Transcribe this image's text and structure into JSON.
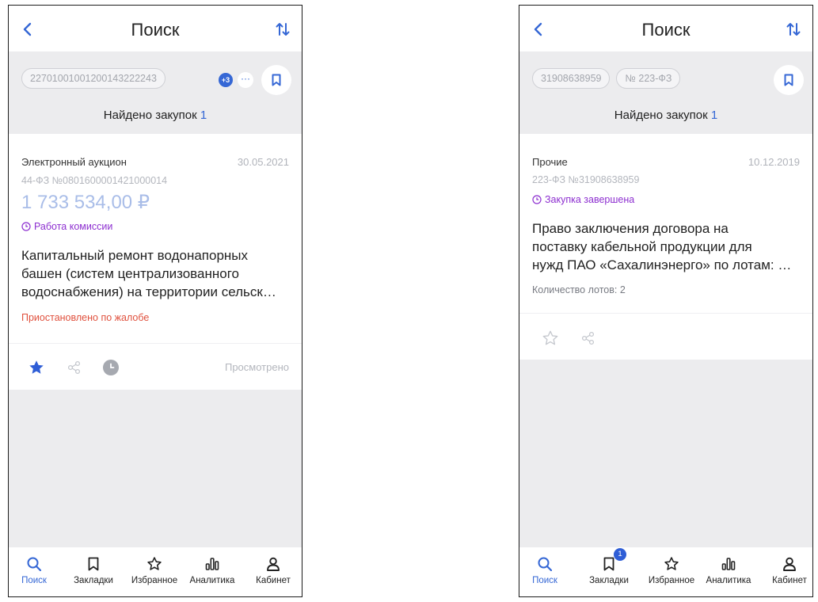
{
  "colors": {
    "accent": "#3567d5",
    "status_purple": "#8d2fd0",
    "warning_red": "#e0513e",
    "price_light_blue": "#a9bde8",
    "gray_bg": "#ececee"
  },
  "left": {
    "title": "Поиск",
    "chips": [
      "22701001001200143222243"
    ],
    "extra_count": "+3",
    "more_label": "···",
    "found_label": "Найдено закупок",
    "found_count": "1",
    "card": {
      "type": "Электронный аукцион",
      "date": "30.05.2021",
      "reg_number": "44-ФЗ №0801600001421000014",
      "price": "1 733 534,00 ₽",
      "status": "Работа комиссии",
      "desc_lines": [
        "Капитальный ремонт водонапорных",
        "башен (систем централизованного",
        "водоснабжения) на территории сельск…"
      ],
      "warning": "Приостановлено по жалобе",
      "viewed": "Просмотрено"
    }
  },
  "right": {
    "title": "Поиск",
    "chips": [
      "31908638959",
      "№ 223-ФЗ"
    ],
    "found_label": "Найдено закупок",
    "found_count": "1",
    "card": {
      "type": "Прочие",
      "date": "10.12.2019",
      "reg_number": "223-ФЗ №31908638959",
      "status": "Закупка завершена",
      "desc_lines": [
        "Право заключения договора на",
        "поставку кабельной продукции для",
        "нужд ПАО «Сахалинэнерго» по лотам: …"
      ],
      "lots": "Количество лотов: 2"
    }
  },
  "tabbar": {
    "items": [
      {
        "label": "Поиск",
        "icon": "search-icon",
        "active": true
      },
      {
        "label": "Закладки",
        "icon": "bookmark-icon"
      },
      {
        "label": "Избранное",
        "icon": "star-icon"
      },
      {
        "label": "Аналитика",
        "icon": "analytics-icon"
      },
      {
        "label": "Кабинет",
        "icon": "user-icon"
      }
    ],
    "bookmarks_badge_right": "1"
  }
}
